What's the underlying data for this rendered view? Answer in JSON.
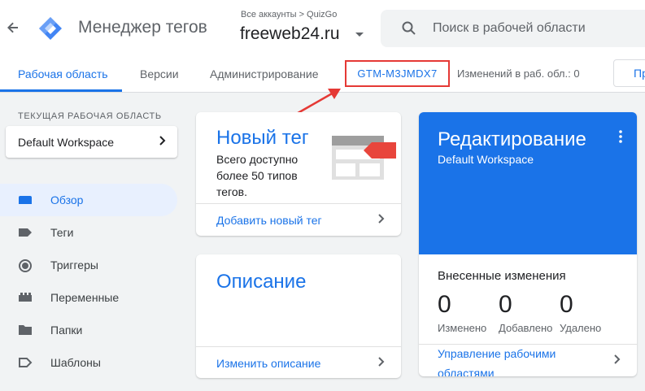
{
  "header": {
    "app_title": "Менеджер тегов",
    "account_crumb": "Все аккаунты > QuizGo",
    "container_name": "freeweb24.ru",
    "search_placeholder": "Поиск в рабочей области"
  },
  "tabs": {
    "workspace": "Рабочая область",
    "versions": "Версии",
    "admin": "Администрирование",
    "container_id": "GTM-M3JMDX7",
    "changes": "Изменений в раб. обл.: 0",
    "preview": "Пр"
  },
  "sidebar": {
    "current_label": "ТЕКУЩАЯ РАБОЧАЯ ОБЛАСТЬ",
    "workspace_name": "Default Workspace",
    "items": [
      {
        "label": "Обзор"
      },
      {
        "label": "Теги"
      },
      {
        "label": "Триггеры"
      },
      {
        "label": "Переменные"
      },
      {
        "label": "Папки"
      },
      {
        "label": "Шаблоны"
      }
    ]
  },
  "new_tag_card": {
    "title": "Новый тег",
    "description": "Всего доступно более 50 типов тегов.",
    "link": "Добавить новый тег"
  },
  "description_card": {
    "title": "Описание",
    "link": "Изменить описание"
  },
  "edit_card": {
    "title": "Редактирование",
    "subtitle": "Default Workspace",
    "changes_title": "Внесенные изменения",
    "modified_count": "0",
    "modified_label": "Изменено",
    "added_count": "0",
    "added_label": "Добавлено",
    "deleted_count": "0",
    "deleted_label": "Удалено",
    "manage_link": "Управление рабочими областями"
  },
  "colors": {
    "accent": "#1a73e8",
    "highlight_border": "#e53935",
    "tag_illustration_red": "#e8453c"
  }
}
